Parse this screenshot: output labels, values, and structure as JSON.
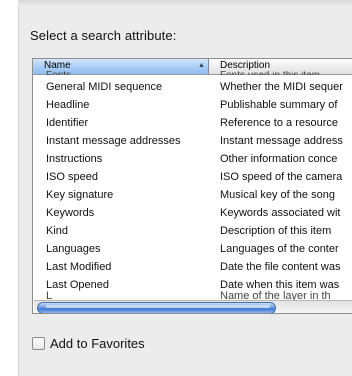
{
  "prompt": "Select a search attribute:",
  "columns": {
    "name": "Name",
    "description": "Description"
  },
  "clipped_top": {
    "name": "Fonts",
    "description": "Fonts used in this item"
  },
  "rows": [
    {
      "name": "General MIDI sequence",
      "description": "Whether the MIDI sequer"
    },
    {
      "name": "Headline",
      "description": "Publishable summary of"
    },
    {
      "name": "Identifier",
      "description": "Reference to a resource"
    },
    {
      "name": "Instant message addresses",
      "description": "Instant message address"
    },
    {
      "name": "Instructions",
      "description": "Other information conce"
    },
    {
      "name": "ISO speed",
      "description": "ISO speed of the camera"
    },
    {
      "name": "Key signature",
      "description": "Musical key of the song"
    },
    {
      "name": "Keywords",
      "description": "Keywords associated wit"
    },
    {
      "name": "Kind",
      "description": "Description of this item"
    },
    {
      "name": "Languages",
      "description": "Languages of the conter"
    },
    {
      "name": "Last Modified",
      "description": "Date the file content was"
    },
    {
      "name": "Last Opened",
      "description": "Date when this item was"
    }
  ],
  "clipped_bottom": {
    "name": "L",
    "description": "Name of the layer in th"
  },
  "favorites": {
    "label": "Add to Favorites",
    "checked": false
  }
}
